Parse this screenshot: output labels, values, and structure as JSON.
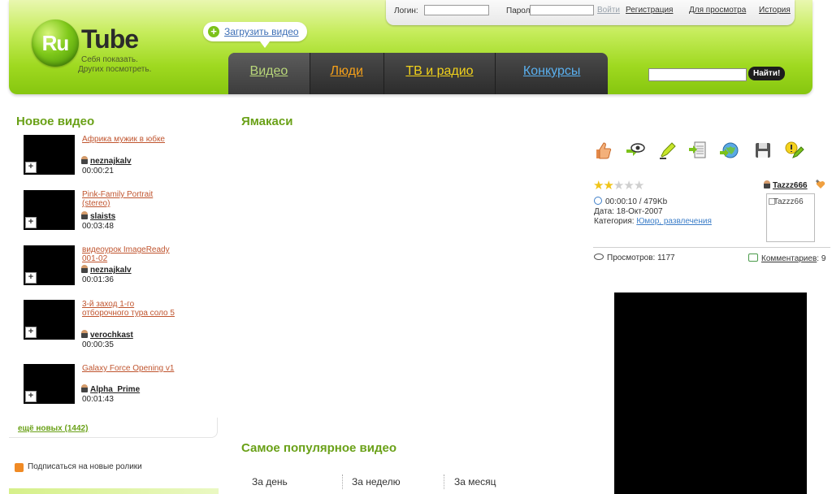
{
  "header": {
    "logo_ru": "Ru",
    "logo_tube": "Tube",
    "tagline1": "Себя показать.",
    "tagline2": "Других посмотреть.",
    "upload_label": "Загрузить видео",
    "tabs": [
      {
        "label": "Видео"
      },
      {
        "label": "Люди"
      },
      {
        "label": "ТВ и радио"
      },
      {
        "label": "Конкурсы"
      }
    ],
    "search_placeholder": "",
    "search_button": "Найти!"
  },
  "login_bar": {
    "login_label": "Логин:",
    "password_label": "Пароль:",
    "enter": "Войти",
    "register": "Регистрация",
    "for_viewing": "Для просмотра",
    "history": "История"
  },
  "left": {
    "title": "Новое видео",
    "videos": [
      {
        "title": "Африка мужик в юбке",
        "user": "neznajkalv",
        "duration": "00:00:21"
      },
      {
        "title": "Pink-Family Portrait (stereo)",
        "user": "slaists",
        "duration": "00:03:48"
      },
      {
        "title": "видеоурок ImageReady 001-02",
        "user": "neznajkalv",
        "duration": "00:01:36"
      },
      {
        "title": "3-й заход 1-го отборочного тура соло 5",
        "user": "verochkast",
        "duration": "00:00:35"
      },
      {
        "title": "Galaxy Force Opening v1",
        "user": "Alpha_Prime",
        "duration": "00:01:43"
      }
    ],
    "more_link": "ещё новых (1442)",
    "subscribe": "Подписаться на новые ролики"
  },
  "center": {
    "video_title": "Ямакаси",
    "popular_title": "Самое популярное видео",
    "periods": [
      "За день",
      "За неделю",
      "За месяц"
    ]
  },
  "right": {
    "rating": {
      "value": 2,
      "max": 5
    },
    "duration_size": "00:00:10 / 479Kb",
    "date_label": "Дата:",
    "date": "18-Окт-2007",
    "category_label": "Категория:",
    "category": "Юмор, развлечения",
    "author": "Tazzz666",
    "avatar_alt": "Tazzz66",
    "views_label": "Просмотров:",
    "views": "1177",
    "comments_label": "Комментариев",
    "comments_count": ": 9"
  },
  "colors": {
    "accent_green": "#6aa118",
    "link_orange": "#c0552f",
    "link_blue": "#3d7ec8"
  }
}
